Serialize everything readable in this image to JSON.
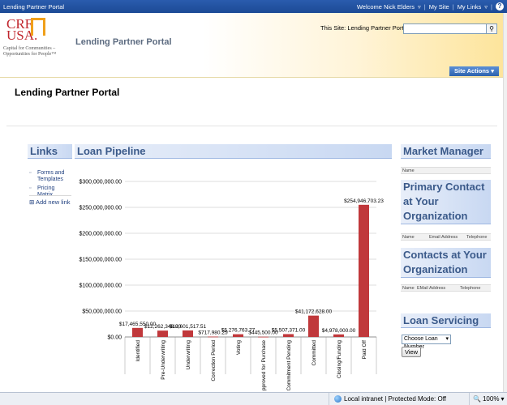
{
  "topbar": {
    "site_name": "Lending Partner Portal",
    "welcome": "Welcome Nick Elders",
    "my_site": "My Site",
    "my_links": "My Links",
    "help": "?"
  },
  "logo": {
    "crf": "CRF",
    "usa": "USA.",
    "tagline": "Capital for Communities –\nOpportunities for People™"
  },
  "header": {
    "title": "Lending Partner Portal",
    "search_scope": "This Site: Lending Partner Port",
    "search_placeholder": "",
    "site_actions": "Site Actions"
  },
  "page_title": "Lending Partner Portal",
  "links": {
    "header": "Links",
    "items": [
      "Forms and Templates",
      "Pricing Matrix"
    ],
    "add_new": "Add new link"
  },
  "pipeline": {
    "header": "Loan Pipeline"
  },
  "market_manager": {
    "header": "Market Manager",
    "col_name": "Name"
  },
  "primary_contact": {
    "header": "Primary Contact at Your Organization",
    "cols": [
      "Name",
      "Email Address",
      "Telephone"
    ]
  },
  "contacts": {
    "header": "Contacts at Your Organization",
    "cols": [
      "Name",
      "EMail Address",
      "Telephone"
    ]
  },
  "loan_servicing": {
    "header": "Loan Servicing",
    "select_value": "Choose Loan Number",
    "view_button": "View"
  },
  "statusbar": {
    "zone": "Local intranet | Protected Mode: Off",
    "zoom": "100%"
  },
  "colors": {
    "bar": "#c0383b",
    "header_blue": "#1c4a95",
    "webpart_title": "#3b5a8a"
  },
  "chart_data": {
    "type": "bar",
    "categories": [
      "Identified",
      "Pre-Underwriting",
      "Underwriting",
      "Correction Period",
      "Voting",
      "Approved for Purchase",
      "Commitment Pending",
      "Committed",
      "Closing/Funding",
      "Paid Off"
    ],
    "values": [
      17465550.0,
      12262348.0,
      12601517.51,
      717980.25,
      5276763.77,
      445500.0,
      5507371.0,
      41172628.0,
      4978000.0,
      254946703.23
    ],
    "value_labels": [
      "$17,465,550.00",
      "$12,262,348.00",
      "$12,601,517.51",
      "$717,980.25",
      "$5,276,763.77",
      "$445,500.00",
      "$5,507,371.00",
      "$41,172,628.00",
      "$4,978,000.00",
      "$254,946,703.23"
    ],
    "y_ticks": [
      0,
      50000000,
      100000000,
      150000000,
      200000000,
      250000000,
      300000000
    ],
    "y_tick_labels": [
      "$0.00",
      "$50,000,000.00",
      "$100,000,000.00",
      "$150,000,000.00",
      "$200,000,000.00",
      "$250,000,000.00",
      "$300,000,000.00"
    ],
    "ylim": [
      0,
      300000000
    ],
    "grid": true,
    "title": "",
    "xlabel": "",
    "ylabel": ""
  }
}
